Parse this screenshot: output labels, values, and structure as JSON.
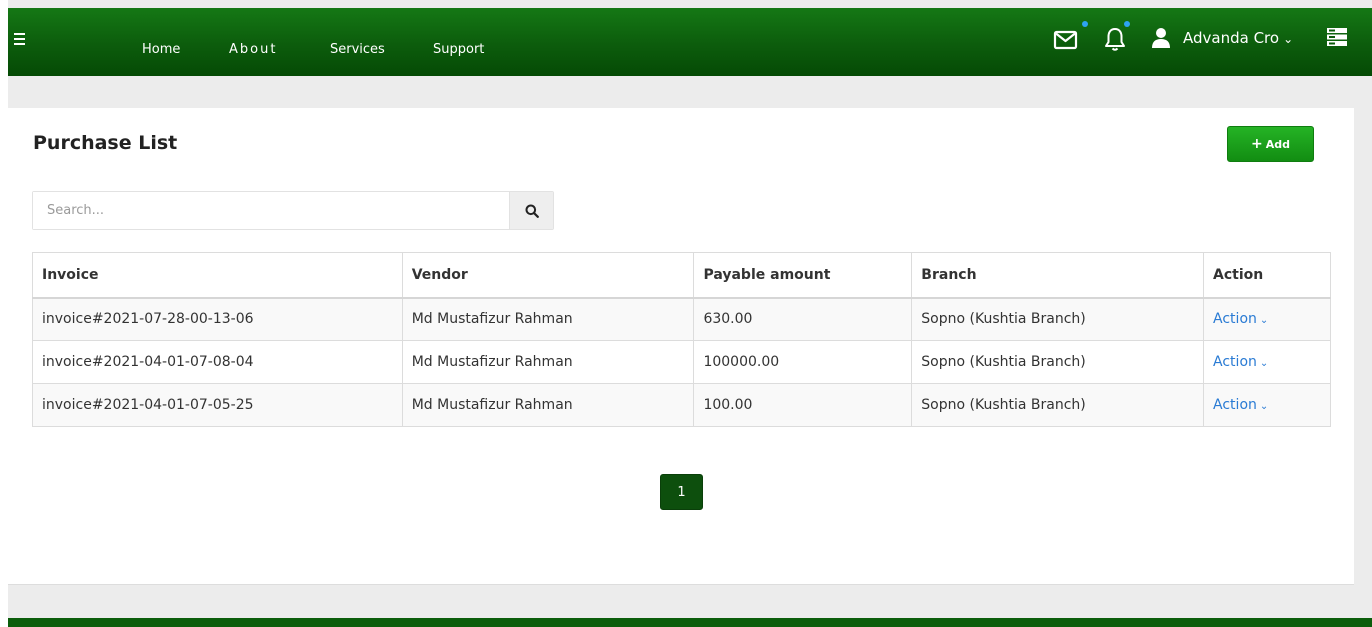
{
  "nav": {
    "links": [
      "Home",
      "About",
      "Services",
      "Support"
    ],
    "user_name": "Advanda Cro"
  },
  "page": {
    "title": "Purchase List",
    "add_label": "Add",
    "search_placeholder": "Search...",
    "current_page": "1"
  },
  "table": {
    "headers": [
      "Invoice",
      "Vendor",
      "Payable amount",
      "Branch",
      "Action"
    ],
    "rows": [
      {
        "invoice": "invoice#2021-07-28-00-13-06",
        "vendor": "Md Mustafizur Rahman",
        "amount": "630.00",
        "branch": "Sopno (Kushtia Branch)",
        "action": "Action"
      },
      {
        "invoice": "invoice#2021-04-01-07-08-04",
        "vendor": "Md Mustafizur Rahman",
        "amount": "100000.00",
        "branch": "Sopno (Kushtia Branch)",
        "action": "Action"
      },
      {
        "invoice": "invoice#2021-04-01-07-05-25",
        "vendor": "Md Mustafizur Rahman",
        "amount": "100.00",
        "branch": "Sopno (Kushtia Branch)",
        "action": "Action"
      }
    ]
  },
  "icons": {
    "menu": "hamburger-icon",
    "mail": "mail-icon",
    "bell": "bell-icon",
    "user": "user-icon",
    "caret": "chevron-down-icon",
    "server": "server-icon",
    "search": "search-icon",
    "plus": "plus-icon"
  },
  "colors": {
    "navbar": "#0c5c0c",
    "add_button": "#1aa01a",
    "notification_dot": "#2ea3f2",
    "action_link": "#2a7bd4",
    "pagination_active": "#0d4f0d"
  }
}
